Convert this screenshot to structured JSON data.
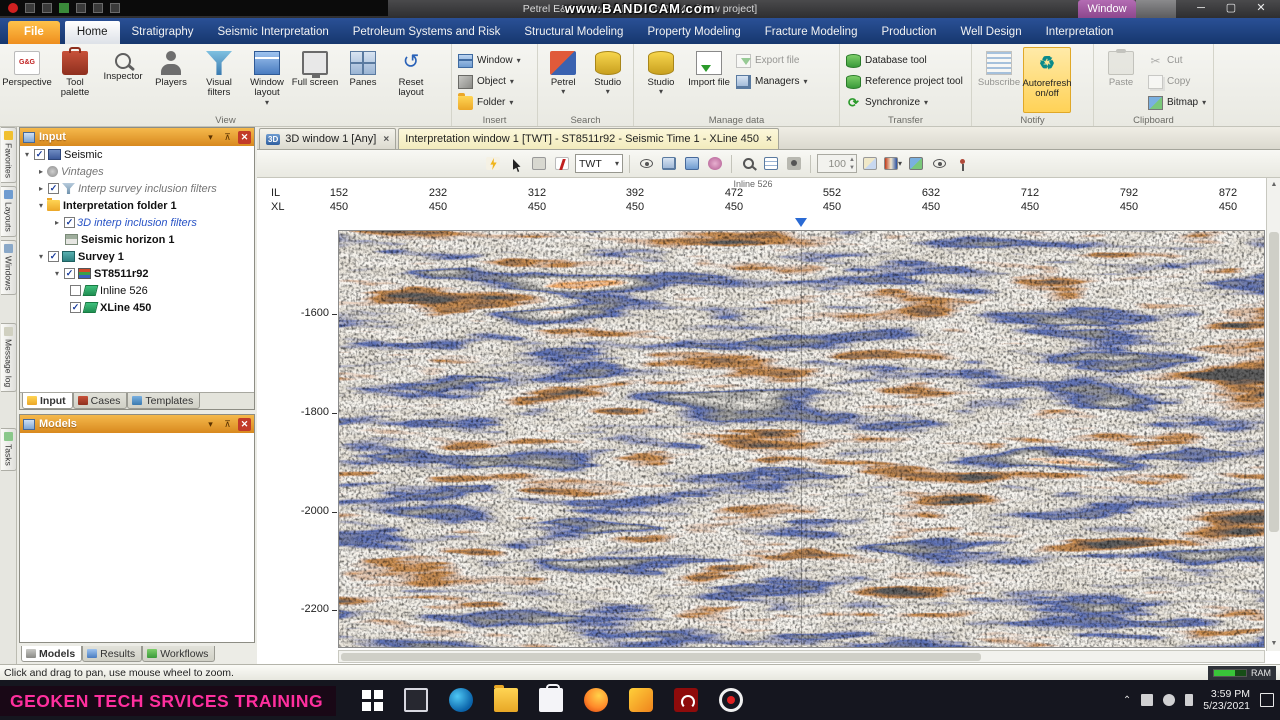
{
  "colors": {
    "banner_pink": "#ff2f9e",
    "panel_header_orange": "#e89a28",
    "ribbon_bar_blue": "#16376e",
    "file_tab_orange": "#f09a28",
    "window_badge_purple": "#a05ca0",
    "autorefresh_highlight": "#ffd257",
    "seismic_red": "#c03a1a",
    "seismic_blue": "#2a4fa0"
  },
  "titlebar": {
    "title": "Petrel E&P Software Platform 2014 - [New project]",
    "watermark": "www.BANDICAM.com",
    "window_badge": "Window",
    "minimize": "─",
    "maximize": "▢",
    "close": "✕"
  },
  "ribbon_tabs": {
    "file": "File",
    "home": "Home",
    "stratigraphy": "Stratigraphy",
    "seismic_interpretation": "Seismic Interpretation",
    "petroleum": "Petroleum Systems and Risk",
    "structural": "Structural Modeling",
    "property": "Property Modeling",
    "fracture": "Fracture Modeling",
    "production": "Production",
    "well_design": "Well Design",
    "interpretation": "Interpretation"
  },
  "ribbon": {
    "view": {
      "label": "View",
      "gg_badge": "G&G",
      "perspective": "Perspective",
      "tool_palette": "Tool palette",
      "inspector": "Inspector",
      "players": "Players",
      "visual_filters": "Visual filters",
      "window_layout": "Window layout",
      "full_screen": "Full screen",
      "panes": "Panes",
      "reset_layout": "Reset layout"
    },
    "insert": {
      "label": "Insert",
      "window": "Window",
      "object": "Object",
      "folder": "Folder"
    },
    "search": {
      "label": "Search",
      "petrel": "Petrel",
      "studio": "Studio"
    },
    "manage": {
      "label": "Manage data",
      "studio": "Studio",
      "import_file": "Import file",
      "export_file": "Export file",
      "managers": "Managers"
    },
    "transfer": {
      "label": "Transfer",
      "database_tool": "Database tool",
      "reference_tool": "Reference project tool",
      "synchronize": "Synchronize"
    },
    "notify": {
      "label": "Notify",
      "subscribe": "Subscribe",
      "autorefresh": "Autorefresh on/off"
    },
    "clipboard": {
      "label": "Clipboard",
      "paste": "Paste",
      "cut": "Cut",
      "copy": "Copy",
      "bitmap": "Bitmap"
    }
  },
  "side_tabs": {
    "favorites": "Favorites",
    "layouts": "Layouts",
    "windows": "Windows",
    "message_log": "Message log",
    "tasks": "Tasks"
  },
  "explorer": {
    "input_title": "Input",
    "models_title": "Models",
    "panel_tabs": {
      "input": "Input",
      "cases": "Cases",
      "templates": "Templates"
    },
    "bottom_tabs": {
      "models": "Models",
      "results": "Results",
      "workflows": "Workflows"
    },
    "tree": {
      "seismic": "Seismic",
      "vintages": "Vintages",
      "interp_survey_filters": "Interp survey inclusion filters",
      "interpretation_folder": "Interpretation folder 1",
      "interp_3d_filters": "3D interp inclusion filters",
      "seismic_horizon": "Seismic horizon 1",
      "survey": "Survey 1",
      "st8511r92": "ST8511r92",
      "inline_526": "Inline 526",
      "xline_450": "XLine 450"
    }
  },
  "doc_tabs": {
    "tab1_icon": "3D",
    "tab1": "3D window 1 [Any]",
    "tab2": "Interpretation window 1 [TWT] - ST8511r92 - Seismic Time 1 - XLine 450"
  },
  "view_toolbar": {
    "domain": "TWT",
    "zoom_value": "100"
  },
  "seismic_view": {
    "annotation": "Inline 526",
    "axis_row1_label": "IL",
    "axis_row2_label": "XL",
    "columns": [
      {
        "il": "152",
        "xl": "450"
      },
      {
        "il": "232",
        "xl": "450"
      },
      {
        "il": "312",
        "xl": "450"
      },
      {
        "il": "392",
        "xl": "450"
      },
      {
        "il": "472",
        "xl": "450"
      },
      {
        "il": "552",
        "xl": "450"
      },
      {
        "il": "632",
        "xl": "450"
      },
      {
        "il": "712",
        "xl": "450"
      },
      {
        "il": "792",
        "xl": "450"
      },
      {
        "il": "872",
        "xl": "450"
      }
    ],
    "depth_ticks": [
      "-1600",
      "-1800",
      "-2000",
      "-2200"
    ]
  },
  "statusbar": {
    "message": "Click and drag to pan, use mouse wheel to zoom.",
    "ram_label": "RAM"
  },
  "taskbar": {
    "time": "3:59 PM",
    "date": "5/23/2021"
  },
  "overlay": {
    "banner": "GEOKEN TECH SRVICES TRAINING"
  }
}
